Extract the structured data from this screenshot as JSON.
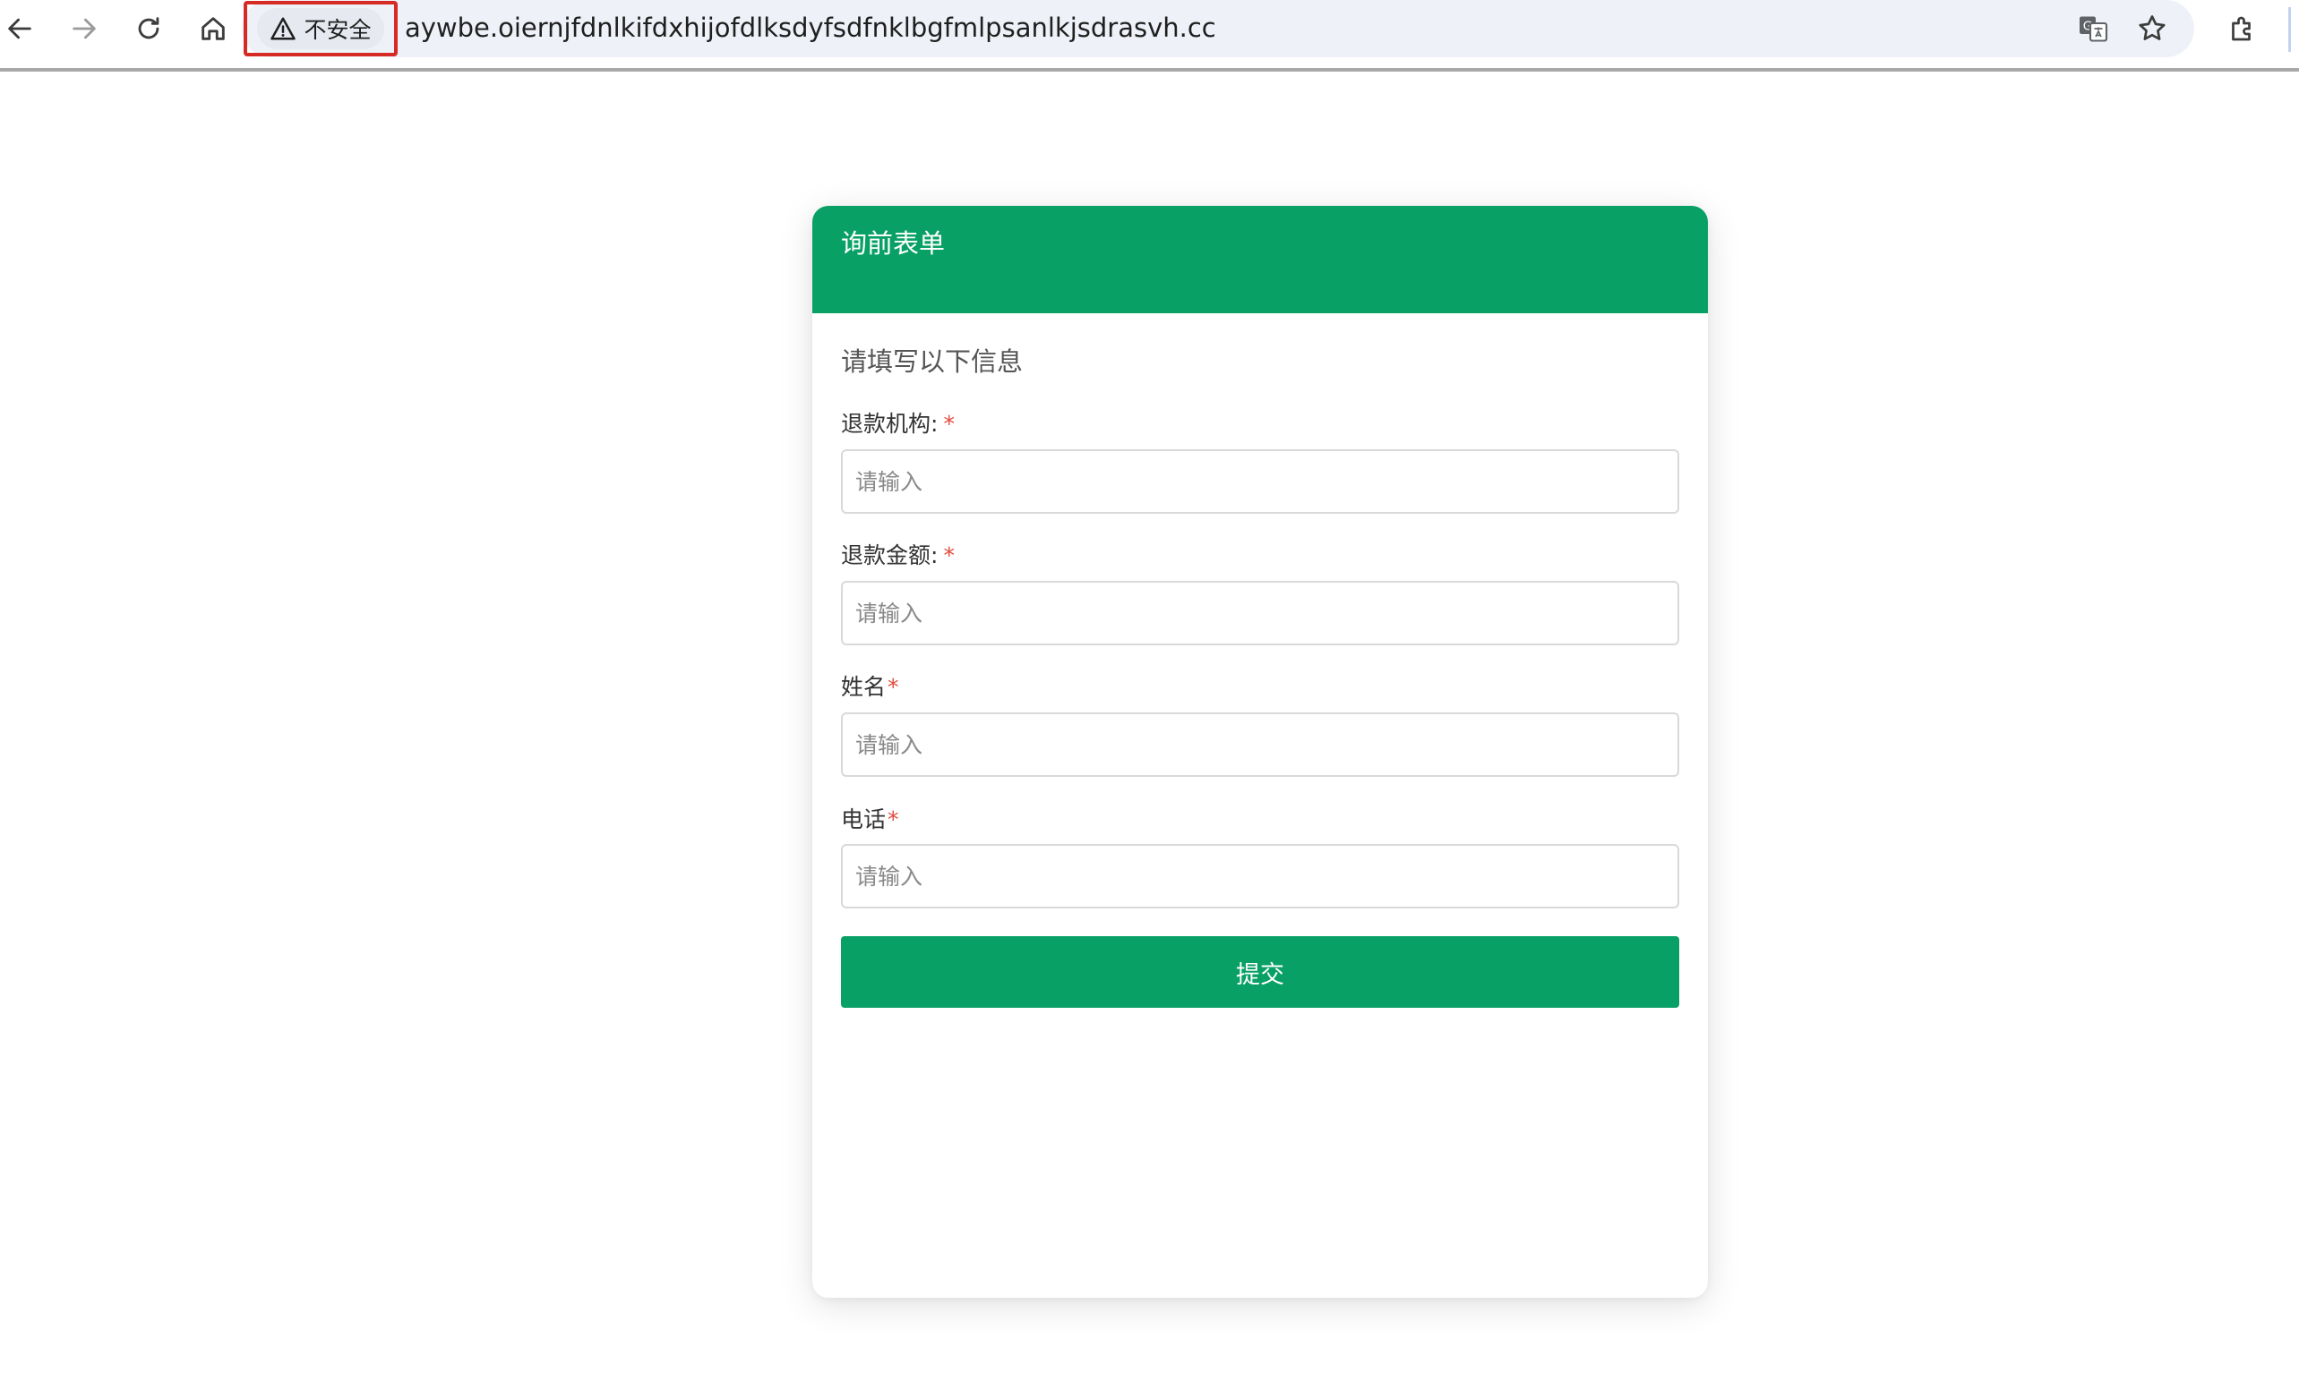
{
  "browser": {
    "url": "aywbe.oiernjfdnlkifdxhijofdlksdyfsdfnklbgfmlpsanlkjsdrasvh.cc",
    "security_label": "不安全",
    "icons": [
      "back-icon",
      "forward-icon",
      "reload-icon",
      "home-icon",
      "warning-icon",
      "translate-icon",
      "bookmark-star-icon",
      "extensions-icon"
    ],
    "colors": {
      "security_highlight": "#d62a24",
      "omnibox_bg": "#eef1f7"
    }
  },
  "form": {
    "title": "询前表单",
    "subtitle": "请填写以下信息",
    "fields": [
      {
        "label": "退款机构:",
        "required_mark": "*",
        "placeholder": "请输入",
        "value": ""
      },
      {
        "label": "退款金额:",
        "required_mark": "*",
        "placeholder": "请输入",
        "value": ""
      },
      {
        "label": "姓名",
        "required_mark": "*",
        "placeholder": "请输入",
        "value": ""
      },
      {
        "label": "电话",
        "required_mark": "*",
        "placeholder": "请输入",
        "value": ""
      }
    ],
    "submit_label": "提交",
    "colors": {
      "accent": "#08a065",
      "required": "#e44a3c"
    }
  }
}
